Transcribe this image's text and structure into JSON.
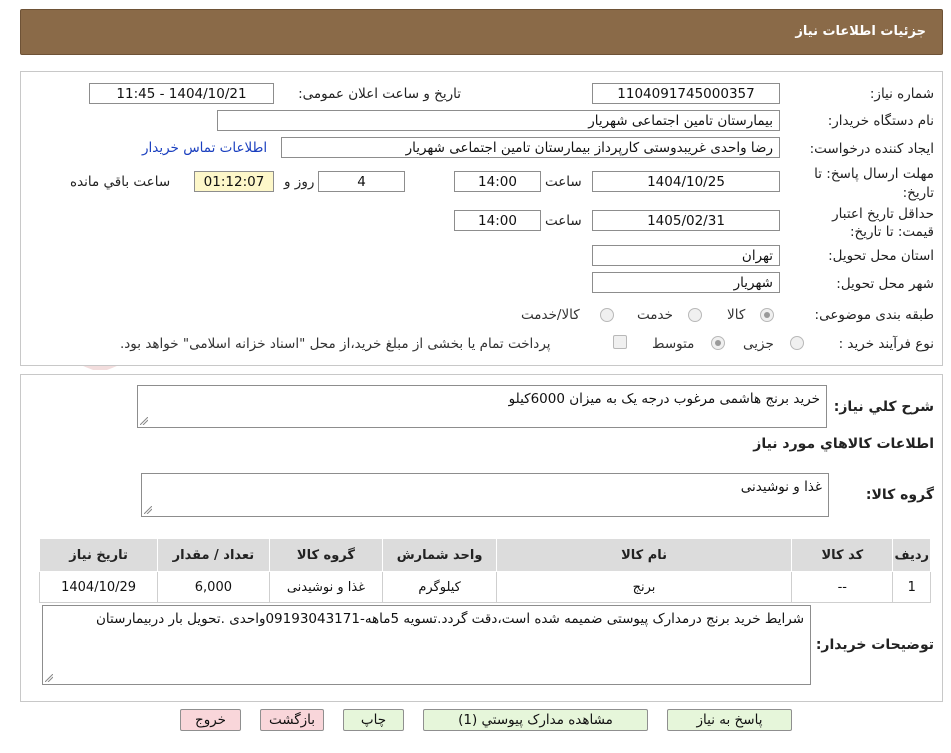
{
  "header": {
    "title": "جزئیات اطلاعات نیاز"
  },
  "form": {
    "need_number_label": "شماره نیاز:",
    "need_number": "1104091745000357",
    "announce_label": "تاریخ و ساعت اعلان عمومی:",
    "announce_value": "1404/10/21 - 11:45",
    "buyer_org_label": "نام دستگاه خریدار:",
    "buyer_org": "بیمارستان تامین اجتماعی شهریار",
    "creator_label": "ایجاد کننده درخواست:",
    "creator": "رضا واحدی غریبدوستی کارپرداز بیمارستان تامین اجتماعی شهریار",
    "contact_link": "اطلاعات تماس خریدار",
    "reply_deadline_label_1": "مهلت ارسال پاسخ: تا",
    "reply_deadline_label_2": "تاریخ:",
    "reply_date": "1404/10/25",
    "time_label": "ساعت",
    "reply_time": "14:00",
    "days_value": "4",
    "days_label": "روز و",
    "remaining_time": "01:12:07",
    "remaining_label": "ساعت باقي مانده",
    "validity_label_1": "حداقل تاریخ اعتبار",
    "validity_label_2": "قیمت: تا تاریخ:",
    "validity_date": "1405/02/31",
    "validity_time": "14:00",
    "province_label": "استان محل تحویل:",
    "province": "تهران",
    "city_label": "شهر محل تحویل:",
    "city": "شهریار",
    "category_label": "طبقه بندی موضوعی:",
    "category_options": [
      "کالا",
      "خدمت",
      "کالا/خدمت"
    ],
    "process_label": "نوع فرآیند خرید :",
    "process_options": [
      "جزیی",
      "متوسط"
    ],
    "payment_note": "پرداخت تمام یا بخشی از مبلغ خرید،از محل \"اسناد خزانه اسلامی\" خواهد بود."
  },
  "summary": {
    "title_label": "شرح کلي نياز:",
    "title_value": "خرید برنج هاشمی مرغوب درجه یک به میزان 6000کیلو",
    "items_heading": "اطلاعات کالاهاي مورد نياز",
    "group_label": "گروه کالا:",
    "group_value": "غذا و نوشیدنی"
  },
  "table": {
    "headers": [
      "رديف",
      "کد کالا",
      "نام کالا",
      "واحد شمارش",
      "گروه کالا",
      "تعداد / مقدار",
      "تاریخ نیاز"
    ],
    "rows": [
      [
        "1",
        "--",
        "برنج",
        "کیلوگرم",
        "غذا و نوشیدنی",
        "6,000",
        "1404/10/29"
      ]
    ]
  },
  "buyer_notes": {
    "label": "توضیحات خریدار:",
    "text": "شرایط خرید برنج درمدارک پیوستی ضمیمه شده است،دقت گردد.تسویه 5ماهه-09193043171واحدی .تحویل بار دربیمارستان"
  },
  "buttons": {
    "reply": "پاسخ به نیاز",
    "attachments": "مشاهده مدارک پیوستي (1)",
    "print": "چاپ",
    "back": "بازگشت",
    "exit": "خروج"
  },
  "watermark": {
    "text": "AriaTender.neT"
  },
  "colors": {
    "header_bg": "#8a6a48",
    "link": "#1a3fbf",
    "timer_bg": "#fdf7c9",
    "btn_green": "#e6f6da",
    "btn_pink": "#f9d6da"
  }
}
